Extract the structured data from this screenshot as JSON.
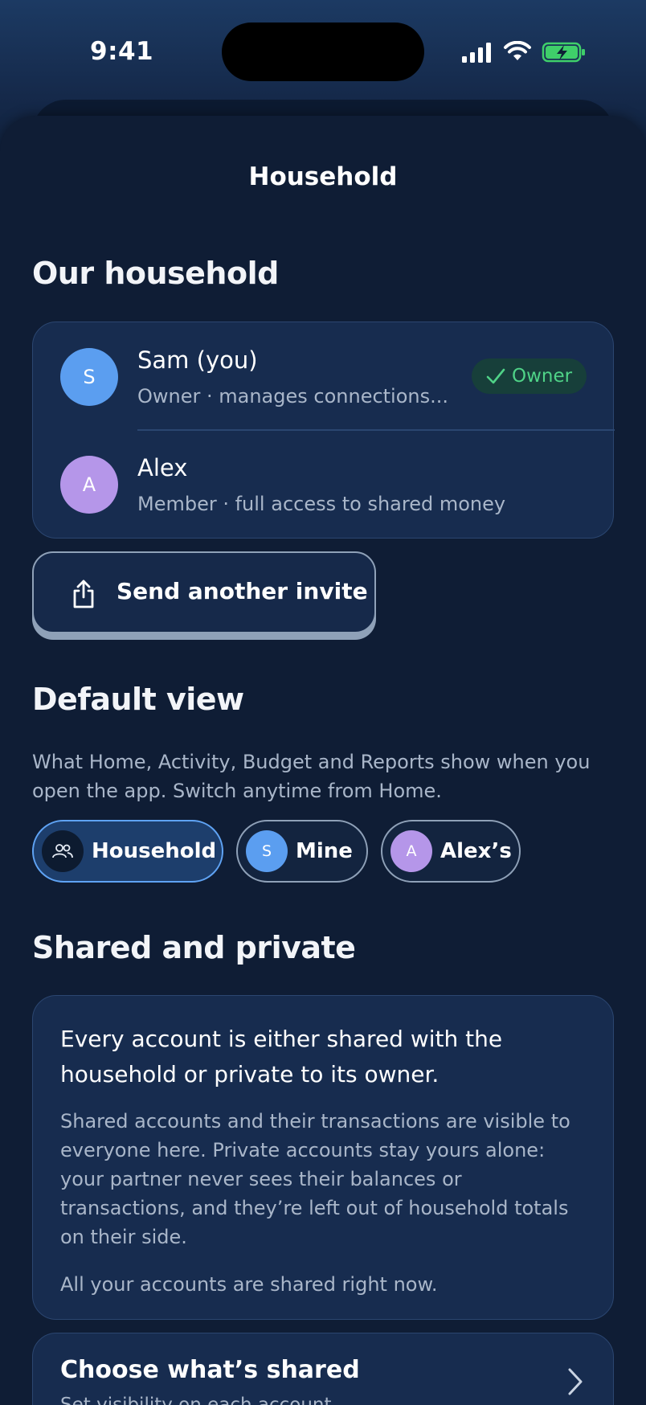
{
  "status_bar": {
    "time": "9:41"
  },
  "sheet": {
    "title": "Household"
  },
  "household": {
    "heading": "Our household",
    "members": [
      {
        "initial": "S",
        "name": "Sam (you)",
        "subtitle": "Owner · manages connections...",
        "badge": "Owner",
        "color": "#5b9ef0"
      },
      {
        "initial": "A",
        "name": "Alex",
        "subtitle": "Member · full access to shared money",
        "color": "#b596e9"
      }
    ],
    "invite_label": "Send another invite"
  },
  "default_view": {
    "heading": "Default view",
    "description": "What Home, Activity, Budget and Reports show when you open the app. Switch anytime from Home.",
    "options": [
      {
        "label": "Household",
        "selected": true,
        "icon": "people-icon"
      },
      {
        "label": "Mine",
        "initial": "S"
      },
      {
        "label": "Alex’s",
        "initial": "A"
      }
    ]
  },
  "shared_private": {
    "heading": "Shared and private",
    "lead": "Every account is either shared with the household or private to its owner.",
    "body": "Shared accounts and their transactions are visible to everyone here. Private accounts stay yours alone: your partner never sees their balances or transactions, and they’re left out of household totals on their side.",
    "note": "All your accounts are shared right now.",
    "choose_title": "Choose what’s shared",
    "choose_subtitle": "Set visibility on each account"
  },
  "colors": {
    "accent_blue": "#5fa3f4",
    "owner_green": "#4fd287",
    "background": "#0f1d35",
    "card": "#172c4f"
  }
}
